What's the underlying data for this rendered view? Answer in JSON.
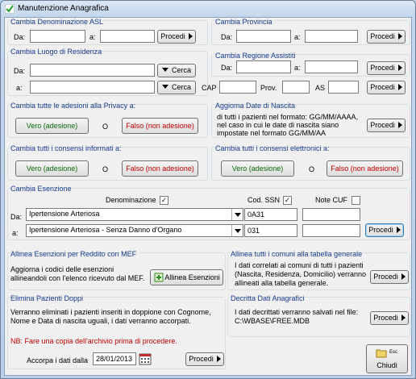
{
  "window": {
    "title": "Manutenzione Anagrafica"
  },
  "asl": {
    "title": "Cambia Denominazione ASL",
    "da": "Da:",
    "a": "a:",
    "procedi": "Procedi"
  },
  "provincia": {
    "title": "Cambia Provincia",
    "da": "Da:",
    "a": "a:",
    "procedi": "Procedi"
  },
  "residenza": {
    "title": "Cambia Luogo di Residenza",
    "da": "Da:",
    "a": "a:",
    "cerca": "Cerca",
    "cap": "CAP",
    "prov": "Prov.",
    "as": "AS"
  },
  "regione": {
    "title": "Cambia Regione Assistiti",
    "da": "Da:",
    "a": "a:",
    "procedi": "Procedi",
    "procedi2": "Procedi"
  },
  "privacy": {
    "title": "Cambia tutte le adesioni alla Privacy a:",
    "vero": "Vero (adesione)",
    "o": "O",
    "falso": "Falso (non adesione)"
  },
  "nascita": {
    "title": "Aggioma Date di Nascita",
    "text": [
      "di tutti i pazienti nel formato: GG/MM/AAAA,",
      "nel caso in cui le date di nascita siano",
      "impostate nel formato GG/MM/AA"
    ],
    "procedi": "Procedi"
  },
  "informati": {
    "title": "Cambia tutti i consensi informati a:",
    "vero": "Vero (adesione)",
    "o": "O",
    "falso": "Falso (non adesione)"
  },
  "elettronici": {
    "title": "Cambia tutti i consensi elettronici a:",
    "vero": "Vero (adesione)",
    "o": "O",
    "falso": "Falso (non adesione)"
  },
  "esenzione": {
    "title": "Cambia Esenzione",
    "denominazione": "Denominazione",
    "denominazione_checked": true,
    "cod_ssn": "Cod. SSN",
    "cod_ssn_checked": true,
    "note_cuf": "Note CUF",
    "note_cuf_checked": false,
    "da": "Da:",
    "a": "a:",
    "da_value": "Ipertensione Arteriosa",
    "a_value": "Ipertensione Arteriosa - Senza Danno d'Organo",
    "da_cod": "0A31",
    "a_cod": "031",
    "procedi": "Procedi"
  },
  "allinea_esenzioni": {
    "title": "Allinea Esenzioni per Reddito con MEF",
    "text": [
      "Aggiorna i codici delle esenzioni",
      "allineandoli con l'elenco ricevuto dal MEF."
    ],
    "button": "Allinea Esenzioni"
  },
  "allinea_comuni": {
    "title": "Allinea tutti i comuni alla tabella generale",
    "text": [
      "I dati correlati ai comuni di tutti i pazienti",
      "(Nascita, Residenza, Domicilio) verranno",
      "allineati alla tabella generale."
    ],
    "procedi": "Procedi"
  },
  "doppi": {
    "title": "Elimina Pazienti Doppi",
    "text": [
      "Verranno eliminati i pazienti inseriti in doppione con Cognome,",
      "Nome e Data di nascita uguali, i dati verranno accorpati."
    ],
    "warning": "NB: Fare una copia dell'archivio prima di procedere.",
    "accorpa_label": "Accorpa i dati dalla",
    "accorpa_date": "28/01/2013",
    "procedi": "Procedi"
  },
  "decritta": {
    "title": "Decritta Dati Anagrafici",
    "text": [
      "I dati decrittati verranno salvati nel file:",
      "C:\\WBASE\\FREE.MDB"
    ],
    "procedi": "Procedi"
  },
  "chiudi": {
    "esc": "Esc",
    "label": "Chiudi"
  }
}
